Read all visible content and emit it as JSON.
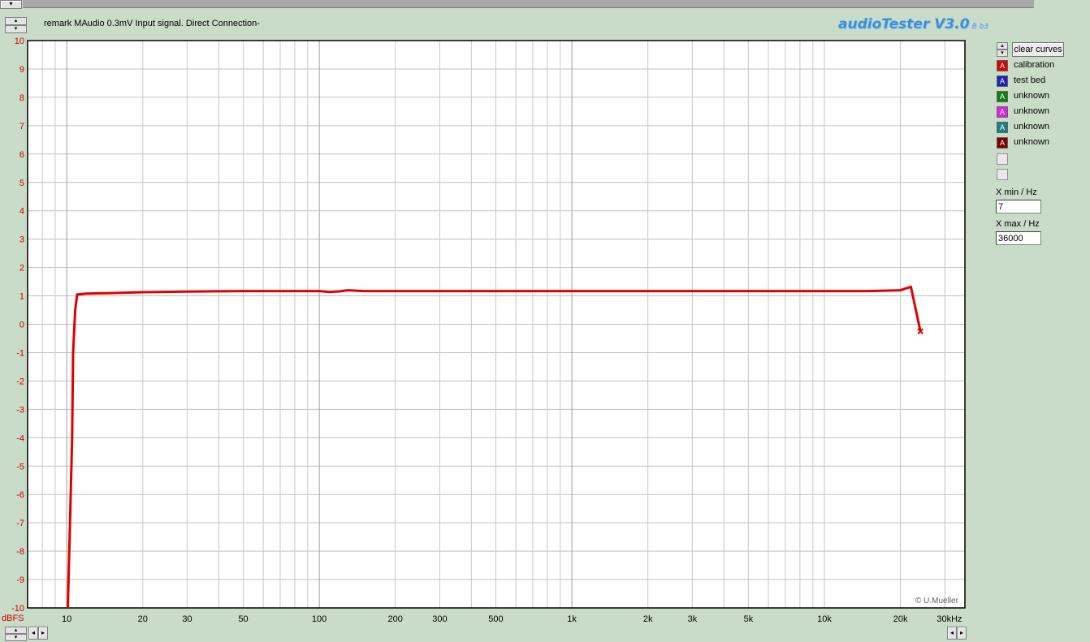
{
  "window": {
    "remark": "remark MAudio  0.3mV Input signal.  Direct Connection-",
    "app_title": "audioTester V3.0",
    "app_version": "B b3",
    "copyright": "© U.Mueller"
  },
  "panel": {
    "clear_button": "clear curves",
    "legend": [
      {
        "label": "calibration",
        "color": "#e00000",
        "glyph": "A"
      },
      {
        "label": "test bed",
        "color": "#2020c0",
        "glyph": "A"
      },
      {
        "label": "unknown",
        "color": "#108010",
        "glyph": "A"
      },
      {
        "label": "unknown",
        "color": "#e020e0",
        "glyph": "A"
      },
      {
        "label": "unknown",
        "color": "#208080",
        "glyph": "A"
      },
      {
        "label": "unknown",
        "color": "#800000",
        "glyph": "A"
      }
    ],
    "xmin_label": "X min / Hz",
    "xmin_value": "7",
    "xmax_label": "X max / Hz",
    "xmax_value": "36000"
  },
  "chart_data": {
    "type": "line",
    "xscale": "log",
    "xlim": [
      7,
      36000
    ],
    "ylim": [
      -10,
      10
    ],
    "ylabel": "dBFS",
    "xlabel": "",
    "x_unit_label": "30kHz",
    "grid": true,
    "yticks": [
      10,
      9,
      8,
      7,
      6,
      5,
      4,
      3,
      2,
      1,
      0,
      -1,
      -2,
      -3,
      -4,
      -5,
      -6,
      -7,
      -8,
      -9,
      -10
    ],
    "xtick_labels": [
      {
        "value": 10,
        "label": "10"
      },
      {
        "value": 20,
        "label": "20"
      },
      {
        "value": 30,
        "label": "30"
      },
      {
        "value": 50,
        "label": "50"
      },
      {
        "value": 100,
        "label": "100"
      },
      {
        "value": 200,
        "label": "200"
      },
      {
        "value": 300,
        "label": "300"
      },
      {
        "value": 500,
        "label": "500"
      },
      {
        "value": 1000,
        "label": "1k"
      },
      {
        "value": 2000,
        "label": "2k"
      },
      {
        "value": 3000,
        "label": "3k"
      },
      {
        "value": 5000,
        "label": "5k"
      },
      {
        "value": 10000,
        "label": "10k"
      },
      {
        "value": 20000,
        "label": "20k"
      },
      {
        "value": 30000,
        "label": "30kHz"
      }
    ],
    "series": [
      {
        "name": "calibration",
        "color": "#e00000",
        "x": [
          10.1,
          10.3,
          10.5,
          10.6,
          10.8,
          11,
          12,
          15,
          20,
          30,
          50,
          100,
          110,
          120,
          130,
          150,
          200,
          500,
          1000,
          2000,
          5000,
          10000,
          15000,
          20000,
          22000,
          24000
        ],
        "y": [
          -10,
          -7,
          -4,
          -1,
          0.5,
          1.05,
          1.08,
          1.1,
          1.13,
          1.15,
          1.17,
          1.17,
          1.14,
          1.16,
          1.2,
          1.17,
          1.17,
          1.17,
          1.17,
          1.17,
          1.17,
          1.17,
          1.17,
          1.2,
          1.32,
          -0.25
        ]
      }
    ]
  }
}
